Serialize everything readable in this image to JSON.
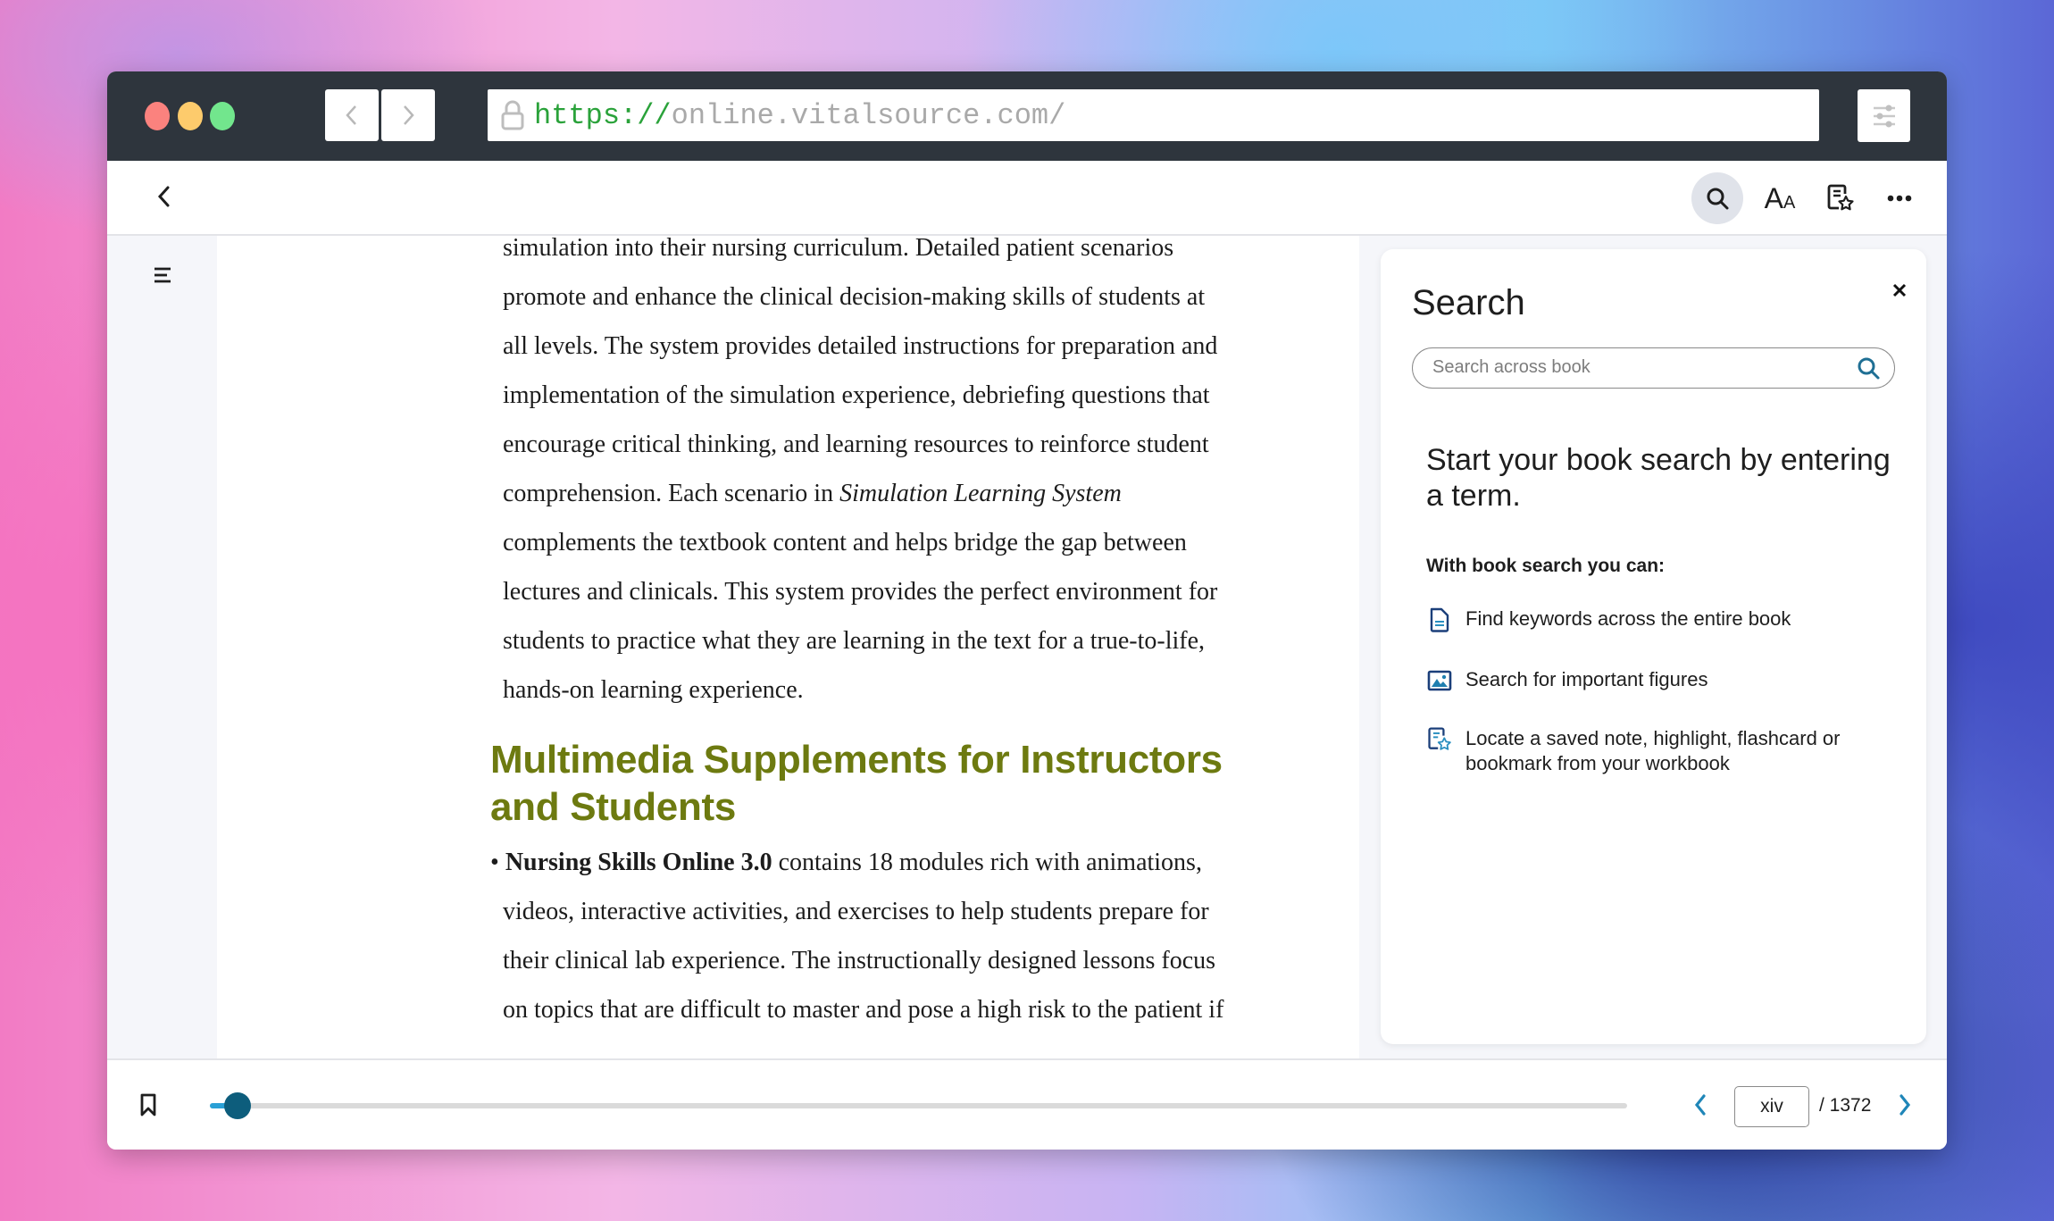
{
  "browser": {
    "url_scheme": "https://",
    "url_host": "online.vitalsource.com/",
    "back_glyph": "‹",
    "forward_glyph": "›"
  },
  "reader_toolbar": {
    "icons": [
      "back-chevron-icon",
      "search-icon",
      "font-size-icon",
      "workbook-icon",
      "more-icon"
    ],
    "font_icon_big": "A",
    "font_icon_small": "A"
  },
  "book": {
    "paragraph_lines": [
      "simulation into their nursing curriculum. Detailed patient scenarios",
      "promote and enhance the clinical decision-making skills of students at",
      "all levels. The system provides detailed instructions for preparation and",
      "implementation of the simulation experience, debriefing questions that",
      "encourage critical thinking, and learning resources to reinforce student"
    ],
    "line6_prefix": "comprehension. Each scenario in ",
    "line6_italic": "Simulation Learning System",
    "paragraph_lines_2": [
      "complements the textbook content and helps bridge the gap between",
      "lectures and clinicals. This system provides the perfect environment for",
      "students to practice what they are learning in the text for a true-to-life,",
      "hands-on learning experience."
    ],
    "heading_line1": "Multimedia Supplements for Instructors",
    "heading_line2": "and Students",
    "heading_color": "#6d7a10",
    "bullet_glyph": "•",
    "bullet_bold": "Nursing Skills Online 3.0",
    "bullet_rest": " contains 18 modules rich with animations,",
    "bullet_lines": [
      "videos, interactive activities, and exercises to help students prepare for",
      "their clinical lab experience. The instructionally designed lessons focus",
      "on topics that are difficult to master and pose a high risk to the patient if"
    ]
  },
  "search_panel": {
    "title": "Search",
    "close_glyph": "✕",
    "placeholder": "Search across book",
    "value": "",
    "prompt": "Start your book search by entering a term.",
    "subheading": "With book search you can:",
    "features": [
      {
        "icon": "document-icon",
        "text": "Find keywords across the entire book"
      },
      {
        "icon": "image-icon",
        "text": "Search for important figures"
      },
      {
        "icon": "workbook-icon",
        "text": "Locate a saved note, highlight, flashcard or bookmark from your workbook"
      }
    ],
    "accent_color": "#1f6f94"
  },
  "footer": {
    "progress_percent": 1,
    "current_page": "xiv",
    "total_pages_label": "/ 1372",
    "thumb_color": "#0d5d7c",
    "nav_color": "#1f86b8"
  }
}
